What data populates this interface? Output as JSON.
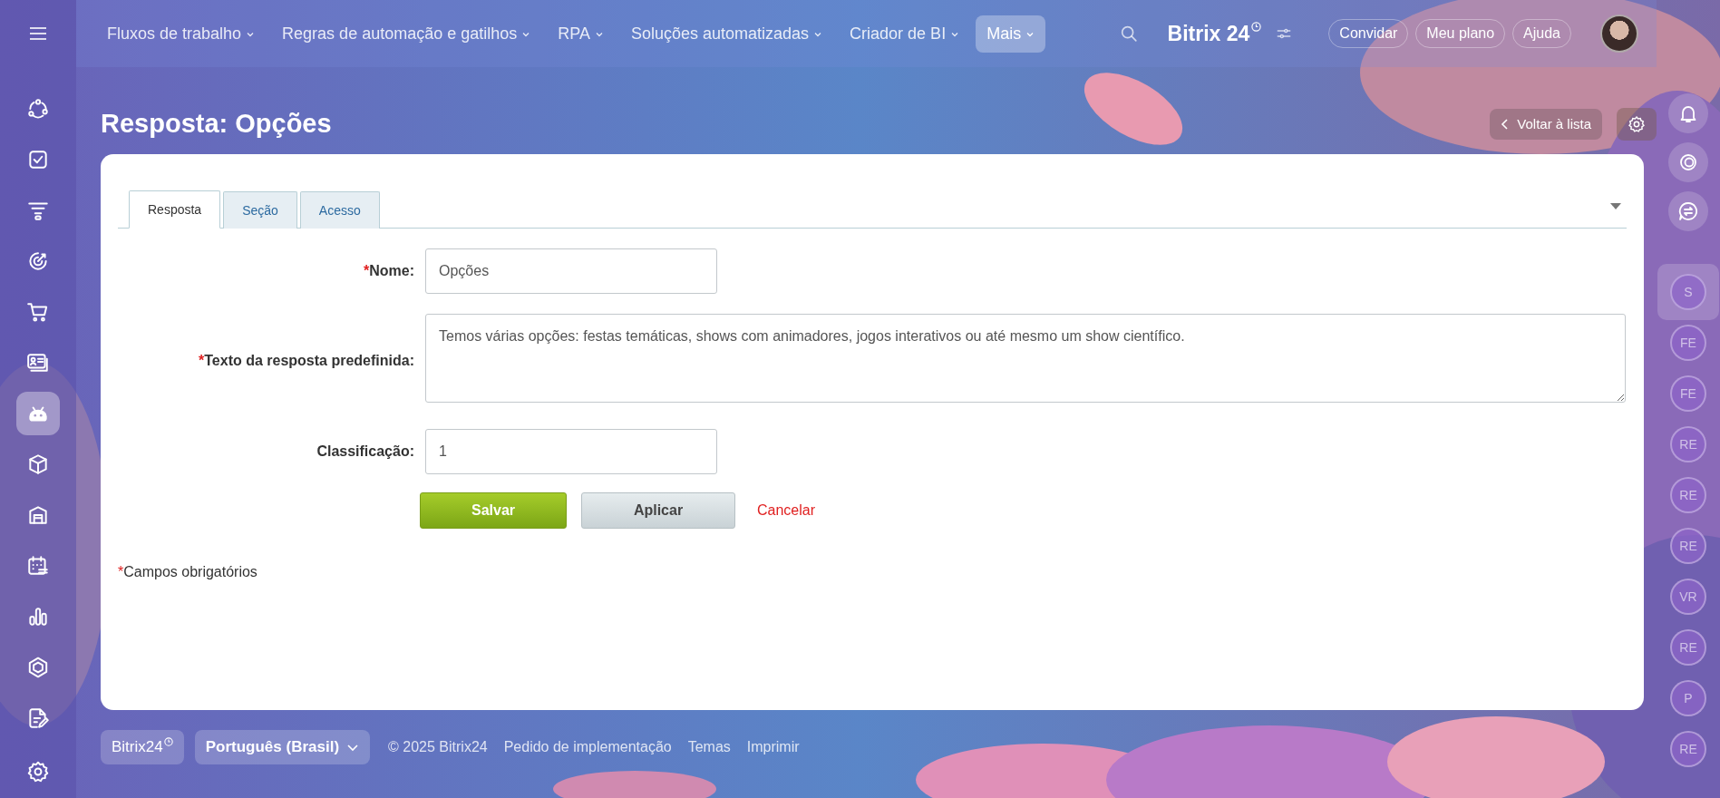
{
  "topbar": {
    "menu": [
      {
        "label": "Fluxos de trabalho",
        "selected": false
      },
      {
        "label": "Regras de automação e gatilhos",
        "selected": false
      },
      {
        "label": "RPA",
        "selected": false
      },
      {
        "label": "Soluções automatizadas",
        "selected": false
      },
      {
        "label": "Criador de BI",
        "selected": false
      },
      {
        "label": "Mais",
        "selected": true
      }
    ],
    "logo": "Bitrix",
    "logo_number": "24",
    "buttons": [
      "Convidar",
      "Meu plano",
      "Ajuda"
    ]
  },
  "sidebar": {
    "items": [
      {
        "selected": false
      },
      {
        "selected": false
      },
      {
        "selected": false
      },
      {
        "selected": false
      },
      {
        "selected": false
      },
      {
        "selected": false
      },
      {
        "selected": true
      },
      {
        "selected": false
      },
      {
        "selected": false
      },
      {
        "selected": false
      },
      {
        "selected": false
      },
      {
        "selected": false
      },
      {
        "selected": false
      }
    ]
  },
  "page": {
    "title": "Resposta: Opções",
    "back_button": "Voltar à lista"
  },
  "tabs": [
    {
      "label": "Resposta",
      "selected": true
    },
    {
      "label": "Seção",
      "selected": false
    },
    {
      "label": "Acesso",
      "selected": false
    }
  ],
  "form": {
    "fields": [
      {
        "label": "Nome:",
        "required": true,
        "kind": "input",
        "value": "Opções"
      },
      {
        "label": "Texto da resposta predefinida:",
        "required": true,
        "kind": "textarea",
        "value": "Temos várias opções: festas temáticas, shows com animadores, jogos interativos ou até mesmo um show científico."
      },
      {
        "label": "Classificação:",
        "required": false,
        "kind": "input",
        "value": "1"
      }
    ],
    "buttons": [
      {
        "label": "Salvar",
        "kind": "primary"
      },
      {
        "label": "Aplicar",
        "kind": "secondary"
      },
      {
        "label": "Cancelar",
        "kind": "link"
      }
    ],
    "required_mark": "*",
    "required_note": "Campos obrigatórios"
  },
  "rail": {
    "chats": [
      {
        "initials": "S",
        "selected": true
      },
      {
        "initials": "FE",
        "selected": false
      },
      {
        "initials": "FE",
        "selected": false
      },
      {
        "initials": "RE",
        "selected": false
      },
      {
        "initials": "RE",
        "selected": false
      },
      {
        "initials": "RE",
        "selected": false
      },
      {
        "initials": "VR",
        "selected": false
      },
      {
        "initials": "RE",
        "selected": false
      },
      {
        "initials": "P",
        "selected": false
      },
      {
        "initials": "RE",
        "selected": false
      }
    ]
  },
  "footer": {
    "brand": "Bitrix24",
    "language": "Português (Brasil)",
    "copyright": "© 2025 Bitrix24",
    "links": [
      "Pedido de implementação",
      "Temas",
      "Imprimir"
    ]
  }
}
